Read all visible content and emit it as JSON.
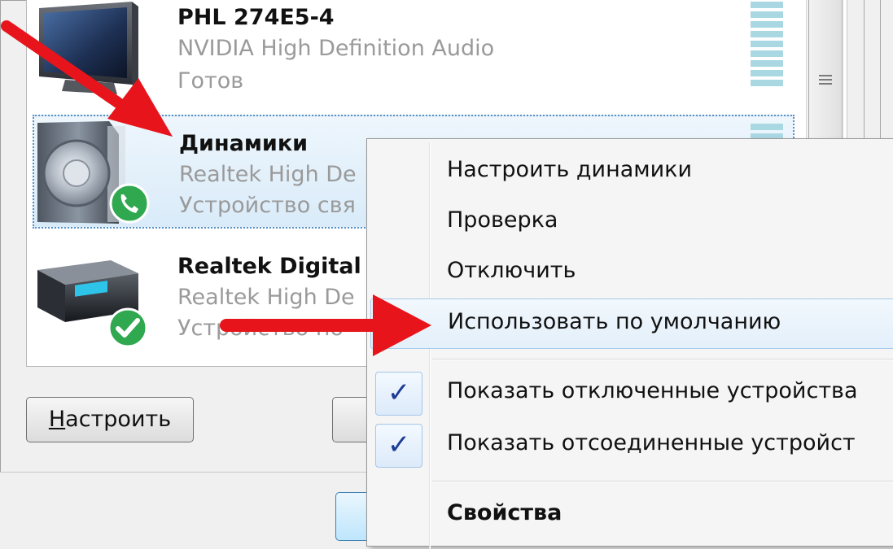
{
  "devices": [
    {
      "name": "PHL 274E5-4",
      "driver": "NVIDIA High Definition Audio",
      "status": "Готов",
      "icon": "monitor-icon"
    },
    {
      "name": "Динамики",
      "driver": "Realtek High De",
      "status": "Устройство свя",
      "icon": "speaker-icon",
      "badge": "phone-badge-icon",
      "selected": true
    },
    {
      "name": "Realtek Digital",
      "driver": "Realtek High De",
      "status": "Устройство по",
      "icon": "digital-output-icon",
      "badge": "default-check-badge-icon"
    }
  ],
  "buttons": {
    "configure_prefix": "Н",
    "configure_rest": "астроить"
  },
  "context_menu": {
    "items": [
      {
        "label": "Настроить динамики"
      },
      {
        "label": "Проверка"
      },
      {
        "label": "Отключить"
      },
      {
        "label": "Использовать по умолчанию"
      },
      {
        "label": "Показать отключенные устройства",
        "checked": true
      },
      {
        "label": "Показать отсоединенные устройст",
        "checked": true
      },
      {
        "label": "Свойства"
      }
    ],
    "check_glyph": "✓"
  },
  "colors": {
    "arrow": "#e8141b",
    "selection_border": "#5a8fc4",
    "meter": "#a9d7e2",
    "check": "#1c3c96"
  }
}
